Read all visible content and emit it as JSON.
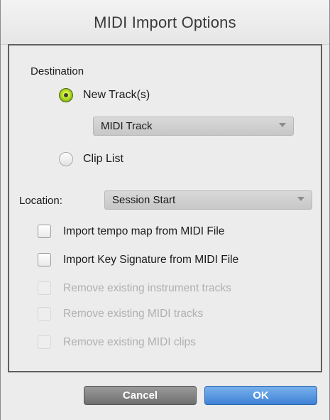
{
  "dialog": {
    "title": "MIDI Import Options"
  },
  "destination": {
    "label": "Destination",
    "options": [
      {
        "label": "New Track(s)",
        "selected": true
      },
      {
        "label": "Clip List",
        "selected": false
      }
    ],
    "track_type": "MIDI Track"
  },
  "location": {
    "label": "Location:",
    "value": "Session Start"
  },
  "checkboxes": [
    {
      "label": "Import tempo map from MIDI File",
      "checked": false,
      "enabled": true
    },
    {
      "label": "Import Key Signature from MIDI File",
      "checked": false,
      "enabled": true
    },
    {
      "label": "Remove existing instrument tracks",
      "checked": false,
      "enabled": false
    },
    {
      "label": "Remove existing MIDI tracks",
      "checked": false,
      "enabled": false
    },
    {
      "label": "Remove existing MIDI clips",
      "checked": false,
      "enabled": false
    }
  ],
  "buttons": {
    "cancel": "Cancel",
    "ok": "OK"
  },
  "colors": {
    "ok_button": "#3f82d6",
    "radio_selected": "#8cc21b"
  }
}
